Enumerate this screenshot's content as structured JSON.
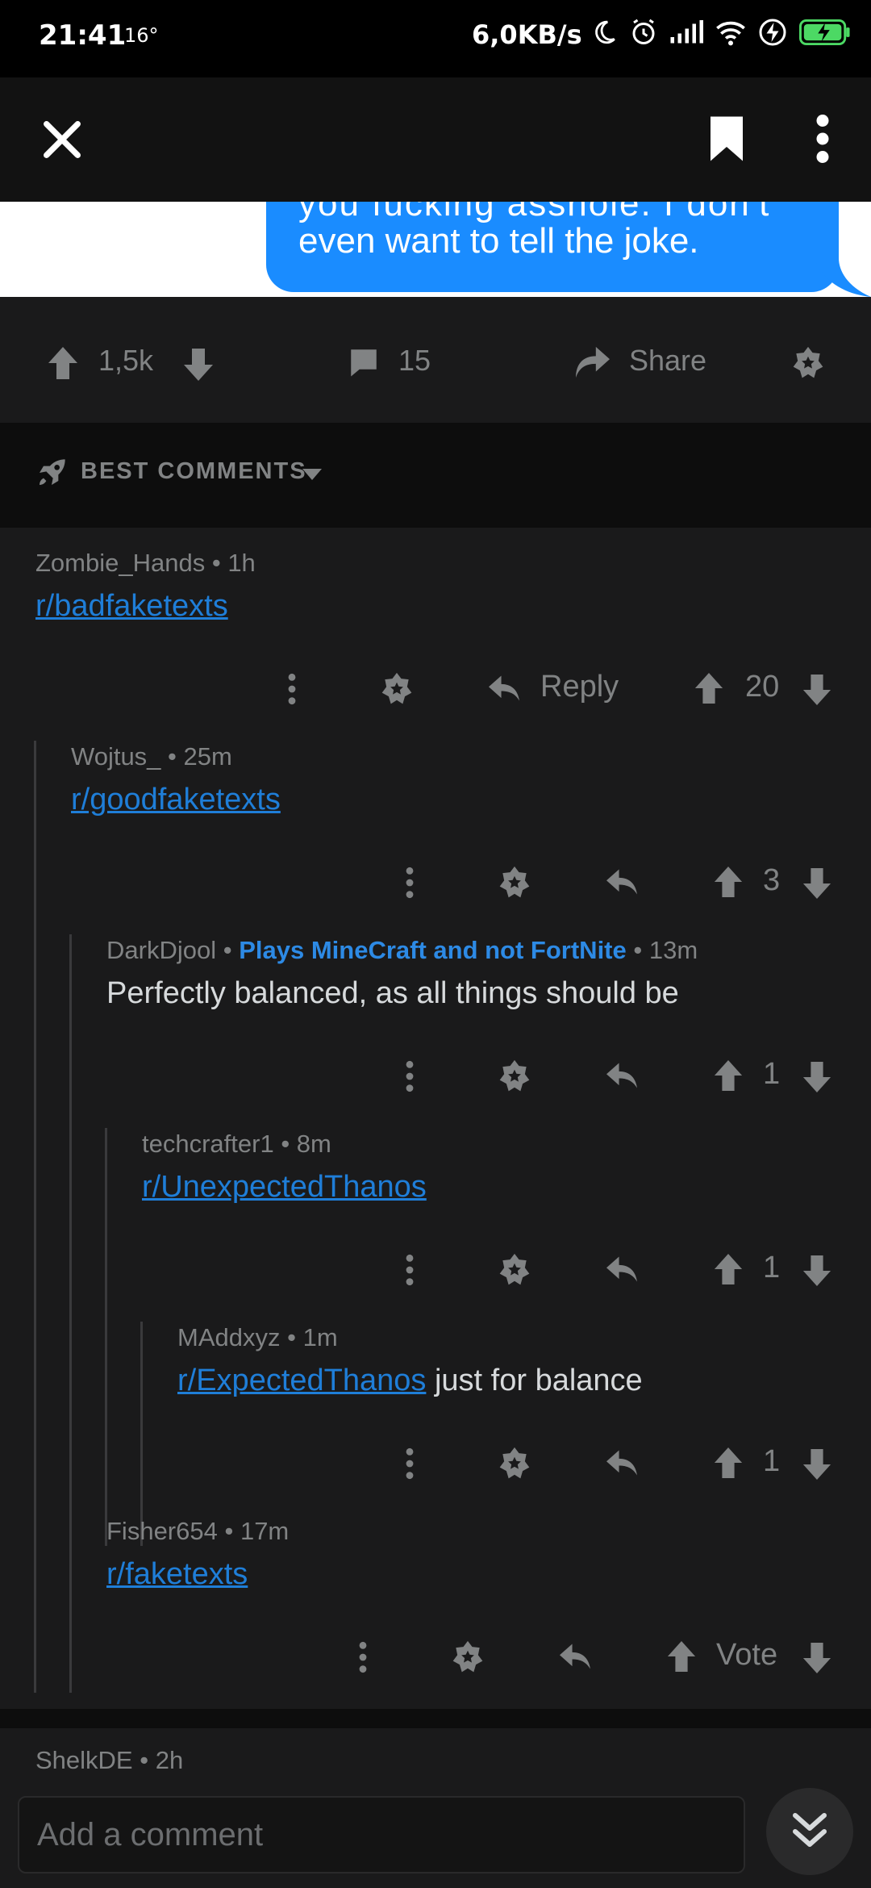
{
  "status_bar": {
    "time": "21:41",
    "temperature": "16°",
    "net_speed": "6,0KB/s",
    "icons": [
      "moon-icon",
      "alarm-icon",
      "signal-icon",
      "wifi-icon",
      "charging-icon",
      "battery-icon"
    ]
  },
  "app_bar": {
    "icons": [
      "close-icon",
      "bookmark-icon",
      "more-vertical-icon"
    ]
  },
  "post_image": {
    "cut_line": "you fucking asshole. I don't",
    "line": "even want to tell the joke.",
    "bubble_color": "#1a8cff"
  },
  "post_actions": {
    "score": "1,5k",
    "comments": "15",
    "share_label": "Share"
  },
  "sort": {
    "label": "BEST COMMENTS"
  },
  "comments": [
    {
      "author": "Zombie_Hands",
      "time": "1h",
      "link": "r/badfaketexts",
      "reply_label": "Reply",
      "score": "20"
    },
    {
      "author": "Wojtus_",
      "time": "25m",
      "link": "r/goodfaketexts",
      "score": "3"
    },
    {
      "author": "DarkDjool",
      "flair": "Plays MineCraft and not FortNite",
      "time": "13m",
      "text": "Perfectly balanced, as all things should be",
      "score": "1"
    },
    {
      "author": "techcrafter1",
      "time": "8m",
      "link": "r/UnexpectedThanos",
      "score": "1"
    },
    {
      "author": "MAddxyz",
      "time": "1m",
      "link": "r/ExpectedThanos",
      "text": "just for balance",
      "score": "1"
    },
    {
      "author": "Fisher654",
      "time": "17m",
      "link": "r/faketexts",
      "score_label": "Vote"
    },
    {
      "author": "ShelkDE",
      "time": "2h"
    }
  ],
  "composer": {
    "placeholder": "Add a comment"
  },
  "colors": {
    "background": "#1a1a1b",
    "link": "#1f7ed8",
    "flair": "#2d8ae5",
    "muted": "#818384"
  }
}
